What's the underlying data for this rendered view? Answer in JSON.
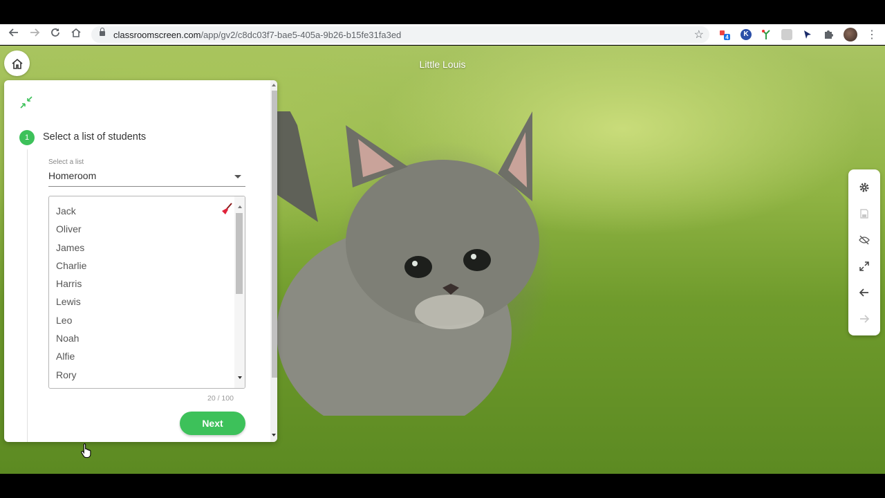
{
  "browser": {
    "url_host": "classroomscreen.com",
    "url_path": "/app/gv2/c8dc03f7-bae5-405a-9b26-b15fe31fa3ed",
    "extension_badge": "4",
    "extension_letter": "K"
  },
  "wallpaper": {
    "title": "Little Louis"
  },
  "panel": {
    "step_number": "1",
    "step_title": "Select a list of students",
    "select_caption": "Select a list",
    "selected_list": "Homeroom",
    "students": [
      "Jack",
      "Oliver",
      "James",
      "Charlie",
      "Harris",
      "Lewis",
      "Leo",
      "Noah",
      "Alfie",
      "Rory"
    ],
    "counter": "20 / 100",
    "next_label": "Next"
  },
  "toolbar": {
    "icons": [
      "gear-icon",
      "save-icon",
      "hide-icon",
      "fullscreen-icon",
      "undo-arrow-icon",
      "redo-arrow-icon"
    ]
  },
  "colors": {
    "accent_green": "#3dc15a",
    "broom_red": "#e0223a"
  }
}
